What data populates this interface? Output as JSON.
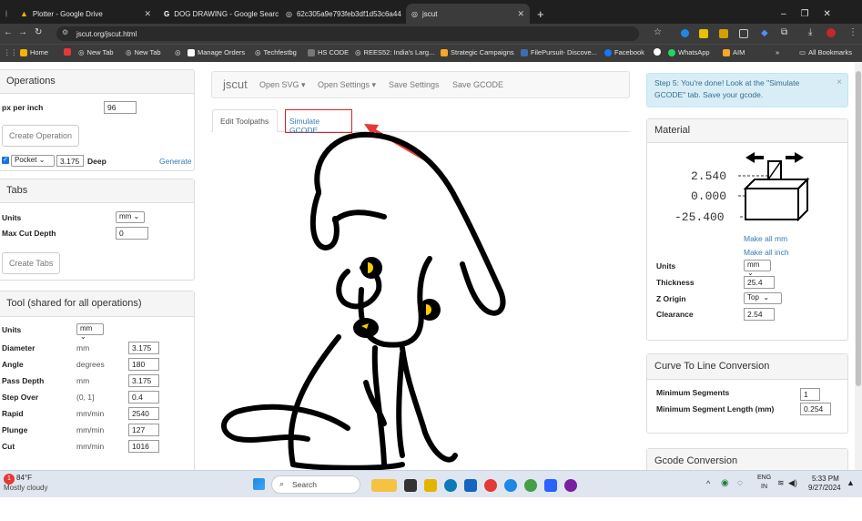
{
  "browser": {
    "tabs": [
      {
        "title": "Plotter - Google Drive"
      },
      {
        "title": "DOG DRAWING - Google Search"
      },
      {
        "title": "62c305a9e793feb3df1d53c6a44"
      },
      {
        "title": "jscut"
      }
    ],
    "url": "jscut.org/jscut.html",
    "bookmarks": [
      "Home",
      "New Tab",
      "New Tab",
      "Manage Orders",
      "Techfestbg",
      "HS CODE",
      "REES52: India's Larg...",
      "Strategic Campaigns",
      "FilePursuit- Discove...",
      "Facebook",
      "WhatsApp",
      "AIM",
      "All Bookmarks"
    ],
    "colors": {
      "dark": "#1f1f1f",
      "toolbar": "#3b3b3b"
    }
  },
  "app": {
    "brand": "jscut",
    "nav": [
      "Open SVG",
      "Open Settings",
      "Save Settings",
      "Save GCODE"
    ],
    "tabs": [
      "Edit Toolpaths",
      "Simulate GCODE"
    ],
    "step_message": "Step 5: You're done! Look at the \"Simulate GCODE\" tab. Save your gcode.",
    "operations": {
      "title": "Operations",
      "px_label": "px per inch",
      "px_value": "96",
      "create_button": "Create Operation",
      "op_type": "Pocket",
      "op_depth": "3.175",
      "op_deep": "Deep",
      "generate": "Generate"
    },
    "tabs_panel": {
      "title": "Tabs",
      "units_label": "Units",
      "units_value": "mm",
      "depth_label": "Max Cut Depth",
      "depth_value": "0",
      "create_button": "Create Tabs"
    },
    "tool": {
      "title": "Tool (shared for all operations)",
      "units_label": "Units",
      "units_value": "mm",
      "rows": [
        {
          "label": "Diameter",
          "unit": "mm",
          "value": "3.175"
        },
        {
          "label": "Angle",
          "unit": "degrees",
          "value": "180"
        },
        {
          "label": "Pass Depth",
          "unit": "mm",
          "value": "3.175"
        },
        {
          "label": "Step Over",
          "unit": "(0, 1]",
          "value": "0.4"
        },
        {
          "label": "Rapid",
          "unit": "mm/min",
          "value": "2540"
        },
        {
          "label": "Plunge",
          "unit": "mm/min",
          "value": "127"
        },
        {
          "label": "Cut",
          "unit": "mm/min",
          "value": "1016"
        }
      ]
    },
    "material": {
      "title": "Material",
      "diagram": [
        "2.540",
        "0.000",
        "-25.400"
      ],
      "make_mm": "Make all mm",
      "make_inch": "Make all inch",
      "units_label": "Units",
      "units_value": "mm",
      "thickness_label": "Thickness",
      "thickness_value": "25.4",
      "zorigin_label": "Z Origin",
      "zorigin_value": "Top",
      "clearance_label": "Clearance",
      "clearance_value": "2.54"
    },
    "curve": {
      "title": "Curve To Line Conversion",
      "min_seg_label": "Minimum Segments",
      "min_seg_value": "1",
      "min_len_label": "Minimum Segment Length (mm)",
      "min_len_value": "0.254"
    },
    "gcode_title": "Gcode Conversion"
  },
  "taskbar": {
    "weather_temp": "84°F",
    "weather_desc": "Mostly cloudy",
    "search": "Search",
    "lang_top": "ENG",
    "lang_bottom": "IN",
    "time": "5:33 PM",
    "date": "9/27/2024"
  }
}
